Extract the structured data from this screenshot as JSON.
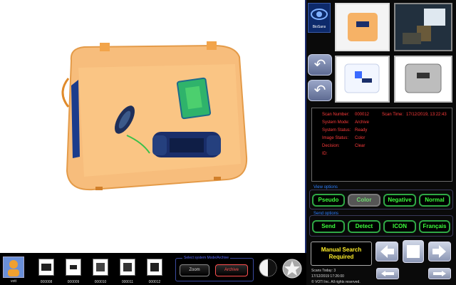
{
  "brand": {
    "logo_text": "BioSans",
    "icon": "eye-logo-icon"
  },
  "info": {
    "scan_number_label": "Scan Number:",
    "scan_number": "000012",
    "scan_time_label": "Scan Time:",
    "scan_time": "17/12/2019, 13:22:43",
    "system_mode_label": "System Mode:",
    "system_mode": "Archive",
    "system_status_label": "System Status:",
    "system_status": "Ready",
    "image_status_label": "Image Status:",
    "image_status": "Color",
    "decision_label": "Decision:",
    "decision": "Clear",
    "id_label": "ID:",
    "id_value": ""
  },
  "view_options": {
    "title": "View options",
    "buttons": [
      "Pseudo",
      "Color",
      "Negative",
      "Normal"
    ],
    "active": "Color"
  },
  "send_options": {
    "title": "Send options",
    "buttons": [
      "Send",
      "Detect",
      "ICON",
      "Français"
    ]
  },
  "filmstrip": {
    "logo": "vott",
    "items": [
      "000008",
      "000009",
      "000010",
      "000011",
      "000012"
    ]
  },
  "mode_panel": {
    "title": "Select system Mode/Archive",
    "zoom": "Zoom",
    "archive": "Archive"
  },
  "manual_search": {
    "line1": "Manual Search",
    "line2": "Required"
  },
  "footer": {
    "scans_today": "Scans Today: 3",
    "datetime": "17/12/2019   17:26:00",
    "copyright": "© VOTI Inc. All rights reserved."
  },
  "colors": {
    "bag_orange": "#f5a24a",
    "status_red": "#ff3b3b",
    "accent_green": "#3cff3c",
    "manual_yellow": "#ffee2a",
    "panel_blue": "#2b7fff"
  }
}
